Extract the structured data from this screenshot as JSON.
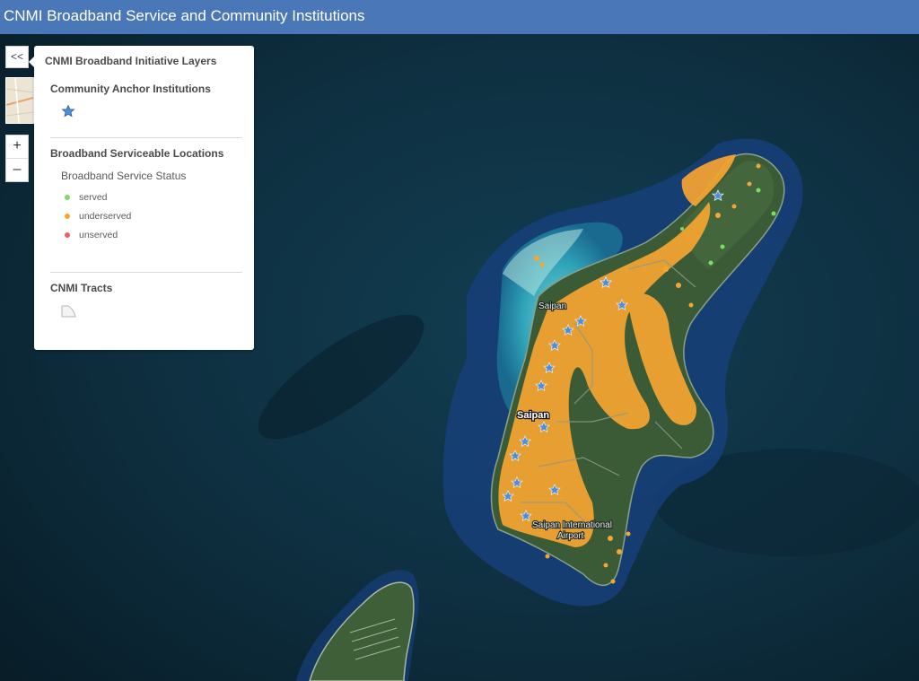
{
  "header": {
    "title": "CNMI Broadband Service and Community Institutions"
  },
  "controls": {
    "collapse_label": "<<",
    "zoom_in_label": "+",
    "zoom_out_label": "–"
  },
  "legend": {
    "title": "CNMI Broadband Initiative Layers",
    "sections": [
      {
        "title": "Community Anchor Institutions",
        "symbol": "star-icon",
        "color": "#4d8fd6"
      },
      {
        "title": "Broadband Serviceable Locations",
        "field": "Broadband Service Status",
        "items": [
          {
            "label": "served",
            "color": "#7cdc68"
          },
          {
            "label": "underserved",
            "color": "#f7a531"
          },
          {
            "label": "unserved",
            "color": "#e8606b"
          }
        ]
      },
      {
        "title": "CNMI Tracts",
        "symbol": "polygon-icon"
      }
    ]
  },
  "map_labels": {
    "saipan_village": "Saipan",
    "saipan_island": "Saipan",
    "airport_line1": "Saipan International",
    "airport_line2": "Airport"
  },
  "colors": {
    "header": "#4a77b8",
    "served": "#7cdc68",
    "underserved": "#f7a531",
    "unserved": "#e8606b",
    "anchor_star": "#4d8fd6",
    "ocean": "#0d2a38",
    "land": "#3b5a36"
  }
}
